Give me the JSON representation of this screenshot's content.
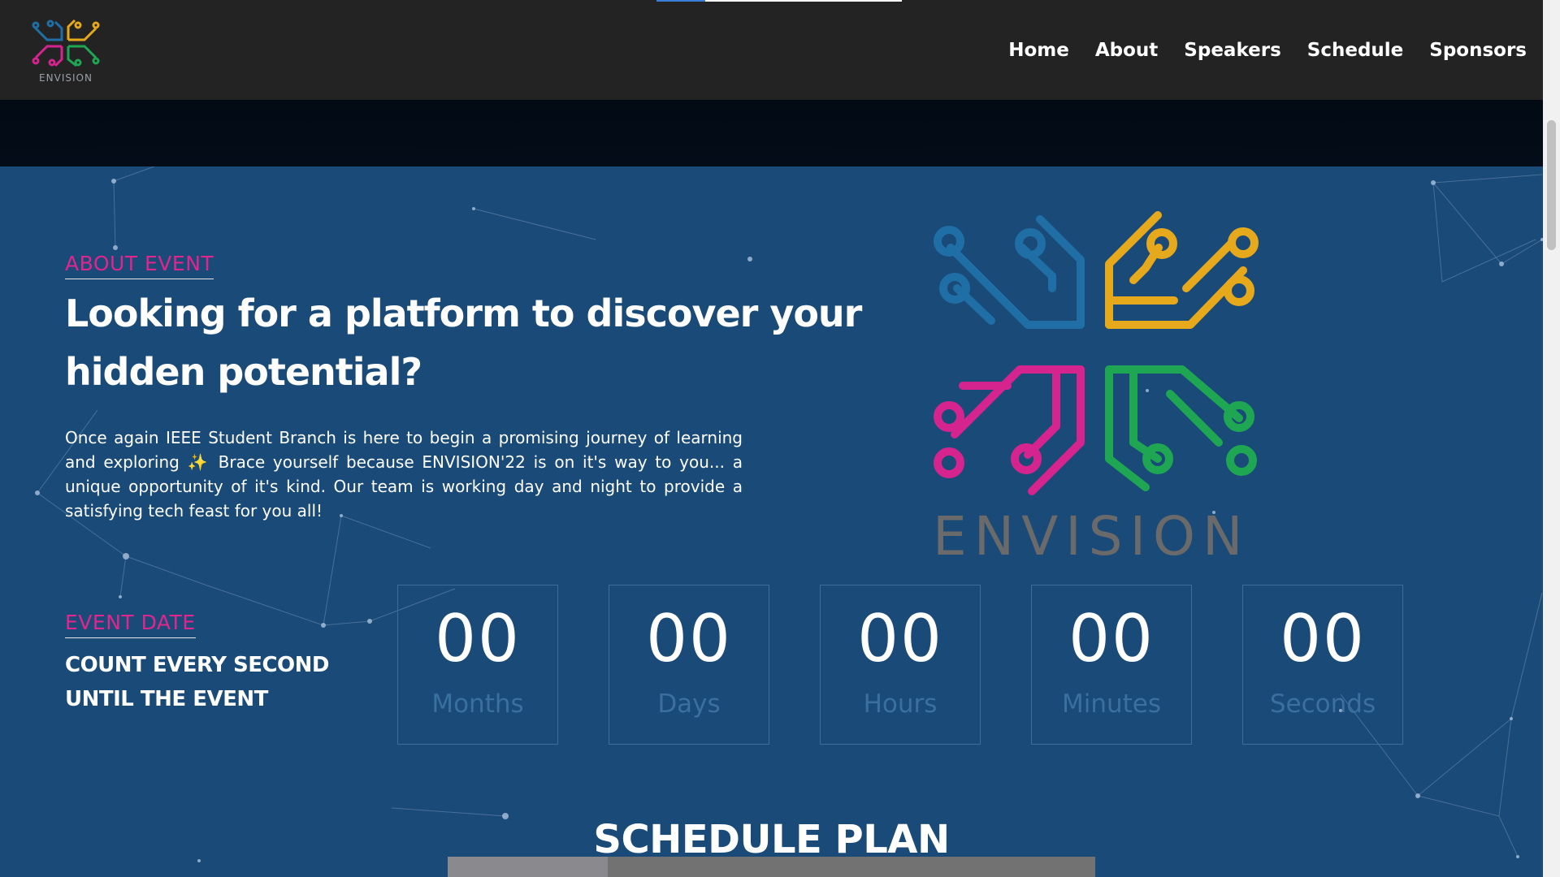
{
  "nav": {
    "brand_name": "ENVISION",
    "links": [
      "Home",
      "About",
      "Speakers",
      "Schedule",
      "Sponsors"
    ]
  },
  "about": {
    "kicker": "ABOUT EVENT",
    "title": "Looking for a platform to discover your hidden potential?",
    "text": "Once again IEEE Student Branch is here to begin a promising journey of learning and exploring ✨ Brace yourself because ENVISION'22 is on it's way to you... a unique opportunity of it's kind. Our team is working day and night to provide a satisfying tech feast for you all!",
    "logo_word": "ENVISION"
  },
  "event": {
    "kicker": "EVENT DATE",
    "subtitle_line1": "COUNT EVERY SECOND",
    "subtitle_line2": "UNTIL THE EVENT"
  },
  "countdown": [
    {
      "value": "00",
      "label": "Months"
    },
    {
      "value": "00",
      "label": "Days"
    },
    {
      "value": "00",
      "label": "Hours"
    },
    {
      "value": "00",
      "label": "Minutes"
    },
    {
      "value": "00",
      "label": "Seconds"
    }
  ],
  "schedule": {
    "title": "SCHEDULE PLAN"
  },
  "colors": {
    "background": "#1a4a78",
    "navbar": "#232323",
    "accent_pink": "#e0268c",
    "logo_blue": "#1f6fa6",
    "logo_yellow": "#e6a91c",
    "logo_magenta": "#d6248f",
    "logo_green": "#1ea653"
  }
}
